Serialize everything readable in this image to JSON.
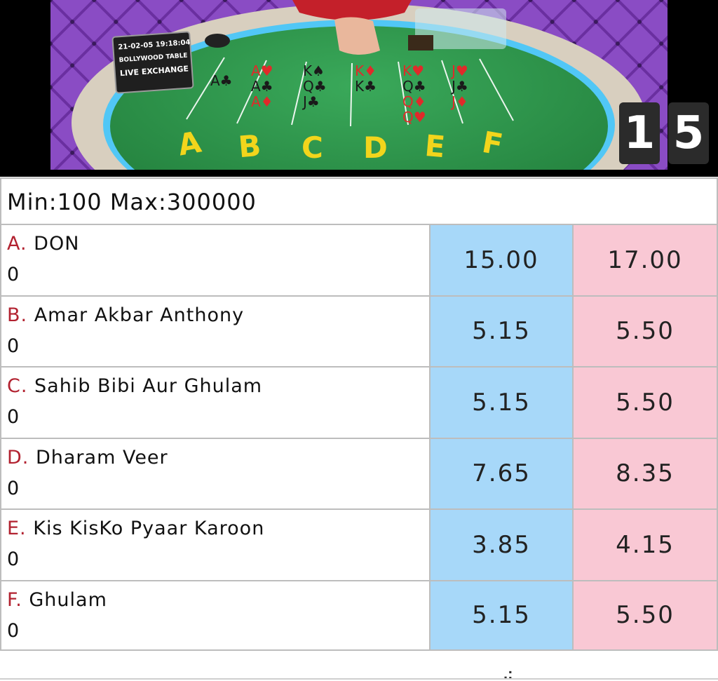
{
  "stream": {
    "overlay": {
      "datetime": "21-02-05 19:18:04",
      "table_name": "BOLLYWOOD TABLE",
      "exchange": "LIVE EXCHANGE"
    },
    "timer": [
      "1",
      "5"
    ],
    "board": {
      "columns": [
        {
          "label": "A",
          "cards": [
            "A♣"
          ]
        },
        {
          "label": "B",
          "cards": [
            "A♥",
            "A♣",
            "A♦"
          ]
        },
        {
          "label": "C",
          "cards": [
            "K♠",
            "Q♣",
            "J♣"
          ]
        },
        {
          "label": "D",
          "cards": [
            "K♦",
            "K♣"
          ]
        },
        {
          "label": "E",
          "cards": [
            "K♥",
            "Q♣",
            "Q♦",
            "Q♥"
          ]
        },
        {
          "label": "F",
          "cards": [
            "J♥",
            "J♣",
            "J♦"
          ]
        }
      ]
    }
  },
  "market": {
    "limits": "Min:100 Max:300000",
    "runners": [
      {
        "letter": "A.",
        "name": "DON",
        "position": "0",
        "back": "15.00",
        "lay": "17.00"
      },
      {
        "letter": "B.",
        "name": "Amar Akbar Anthony",
        "position": "0",
        "back": "5.15",
        "lay": "5.50"
      },
      {
        "letter": "C.",
        "name": "Sahib Bibi Aur Ghulam",
        "position": "0",
        "back": "5.15",
        "lay": "5.50"
      },
      {
        "letter": "D.",
        "name": "Dharam Veer",
        "position": "0",
        "back": "7.65",
        "lay": "8.35"
      },
      {
        "letter": "E.",
        "name": "Kis KisKo Pyaar Karoon",
        "position": "0",
        "back": "3.85",
        "lay": "4.15"
      },
      {
        "letter": "F.",
        "name": "Ghulam",
        "position": "0",
        "back": "5.15",
        "lay": "5.50"
      }
    ],
    "more": ".:"
  },
  "colors": {
    "back": "#a7d8f9",
    "lay": "#f9c8d4",
    "letter": "#b22230",
    "felt": "#2f9a4e",
    "table_label": "#f2d51c"
  }
}
